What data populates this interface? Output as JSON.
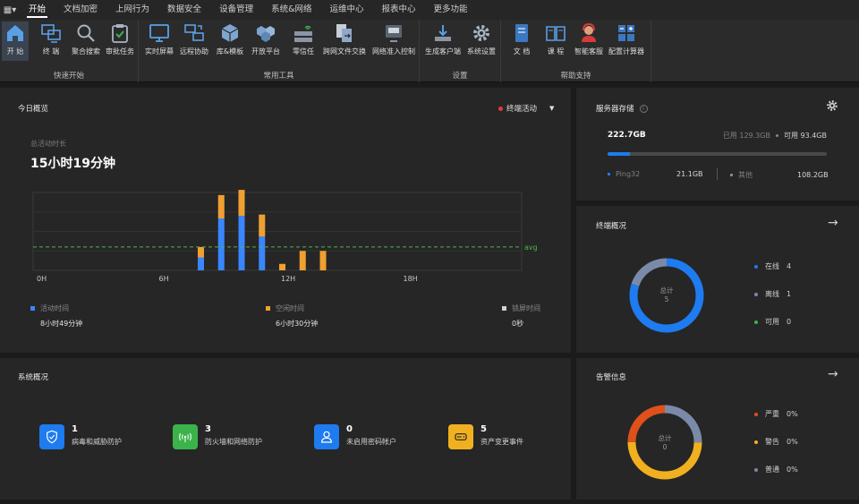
{
  "menu": {
    "items": [
      "开始",
      "文档加密",
      "上网行为",
      "数据安全",
      "设备管理",
      "系统&网络",
      "运维中心",
      "报表中心",
      "更多功能"
    ]
  },
  "ribbon": {
    "groups": [
      {
        "label": "快速开始",
        "buttons": [
          "开 始",
          "终 端",
          "聚合搜索",
          "审批任务"
        ]
      },
      {
        "label": "常用工具",
        "buttons": [
          "实时屏幕",
          "远程协助",
          "库&模板",
          "开放平台",
          "零信任",
          "跨网文件交换",
          "网络准入控制"
        ]
      },
      {
        "label": "设置",
        "buttons": [
          "生成客户端",
          "系统设置"
        ]
      },
      {
        "label": "帮助支持",
        "buttons": [
          "文 档",
          "课 程",
          "智能客服",
          "配置计算器"
        ]
      }
    ]
  },
  "today": {
    "title": "今日概览",
    "selector": "终端活动",
    "total_label": "总活动时长",
    "total_value": "15小时19分钟",
    "avg_label": "avg",
    "legend": [
      {
        "key": "活动时间",
        "value": "8小时49分钟",
        "color": "#3a86ff"
      },
      {
        "key": "空闲时间",
        "value": "6小时30分钟",
        "color": "#f0a030"
      },
      {
        "key": "锁屏时间",
        "value": "0秒",
        "color": "#d0d0d0"
      }
    ]
  },
  "chart_data": {
    "type": "bar",
    "x_tick_labels": [
      "0H",
      "6H",
      "12H",
      "18H"
    ],
    "xlim": [
      0,
      24
    ],
    "ylim": [
      0,
      60
    ],
    "grid": true,
    "series": [
      {
        "name": "活动时间",
        "color": "#3a86ff",
        "x": [
          8,
          9,
          10,
          11
        ],
        "values": [
          10,
          40,
          42,
          26
        ]
      },
      {
        "name": "空闲时间",
        "color": "#f0a030",
        "x": [
          8,
          9,
          10,
          11,
          12,
          13,
          14
        ],
        "values": [
          8,
          18,
          20,
          17,
          5,
          15,
          15
        ]
      }
    ],
    "avg_value": 18
  },
  "storage": {
    "title": "服务器存储",
    "total": "222.7GB",
    "used_label": "已用 129.3GB",
    "free_label": "可用 93.4GB",
    "used_fraction": 0.1,
    "items": [
      {
        "name": "Ping32",
        "value": "21.1GB"
      },
      {
        "name": "其他",
        "value": "108.2GB"
      }
    ]
  },
  "terminals": {
    "title": "终端概况",
    "center_label": "总计",
    "center_value": "5",
    "legend": [
      {
        "name": "在线",
        "value": "4",
        "color": "#1e7bf0"
      },
      {
        "name": "离线",
        "value": "1",
        "color": "#7a8aa8"
      },
      {
        "name": "可用",
        "value": "0",
        "color": "#3bb34a"
      }
    ]
  },
  "system": {
    "title": "系统概况",
    "stats": [
      {
        "num": "1",
        "label": "病毒和威胁防护",
        "color": "#1e7bf0",
        "icon": "shield-icon"
      },
      {
        "num": "3",
        "label": "防火墙和网络防护",
        "color": "#3bb34a",
        "icon": "wifi-icon"
      },
      {
        "num": "0",
        "label": "未启用密码帐户",
        "color": "#1e7bf0",
        "icon": "user-icon"
      },
      {
        "num": "5",
        "label": "资产变更事件",
        "color": "#f0b020",
        "icon": "drive-icon"
      }
    ]
  },
  "alerts": {
    "title": "告警信息",
    "center_label": "总计",
    "center_value": "0",
    "legend": [
      {
        "name": "严重",
        "value": "0%",
        "color": "#e0501a"
      },
      {
        "name": "警告",
        "value": "0%",
        "color": "#f0b020"
      },
      {
        "name": "普通",
        "value": "0%",
        "color": "#7a8aa8"
      }
    ]
  }
}
